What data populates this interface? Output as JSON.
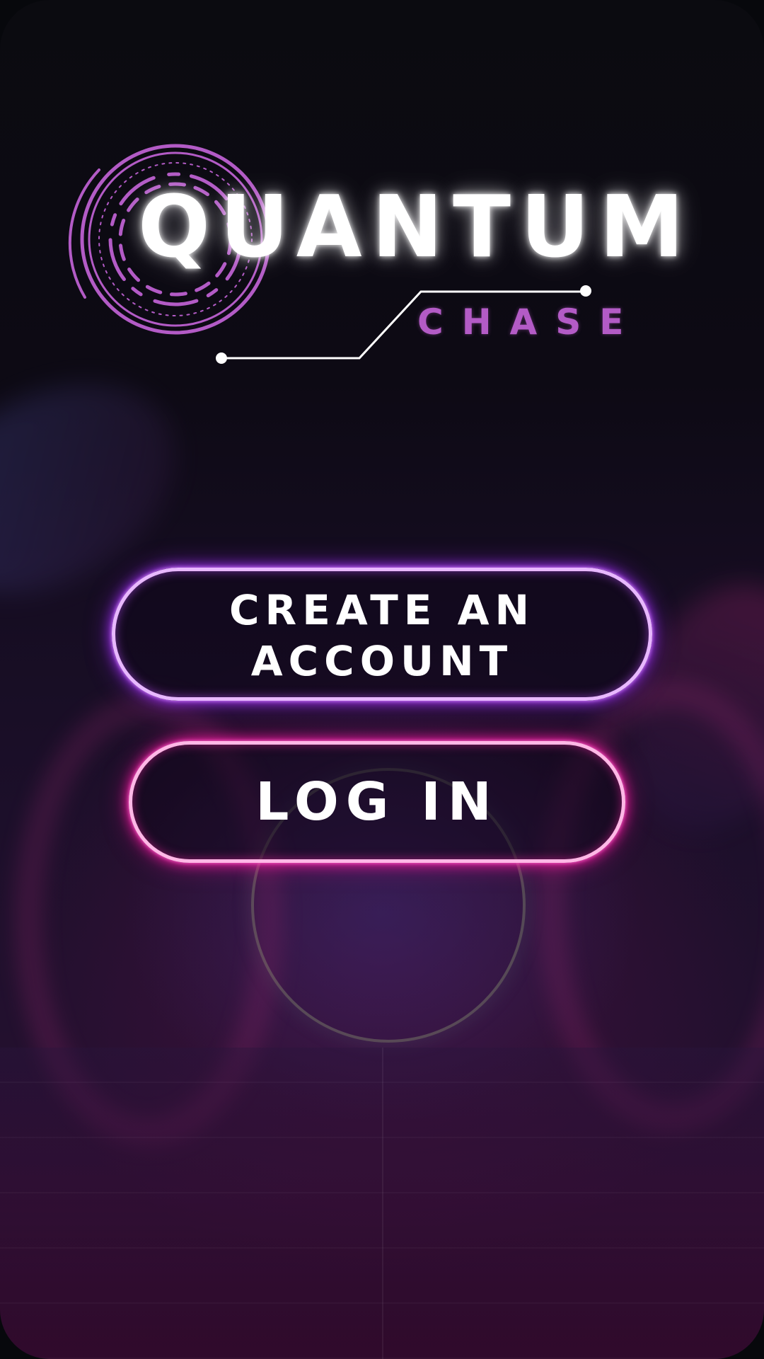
{
  "app": {
    "title": "QUANTUM",
    "subtitle": "CHASE"
  },
  "actions": {
    "create_account_line1": "CREATE AN",
    "create_account_line2": "ACCOUNT",
    "login_label": "LOG IN"
  },
  "colors": {
    "logo_purple": "#b35bc6",
    "create_glow": "#a935ff",
    "login_glow": "#ff1aa8",
    "background": "#0b0b10"
  },
  "icons": {
    "logo_emblem": "concentric-rings-icon"
  }
}
